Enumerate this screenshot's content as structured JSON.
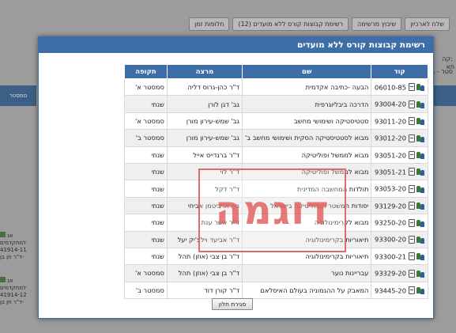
{
  "background": {
    "tabs": [
      "שלח לארכיון",
      "שיבוץ מרשימה",
      "רשימת קבוצות קורס ללא מועדים (12)",
      "חלופות זמן"
    ],
    "left_column_header": "סמסטר",
    "left_cells": [
      {
        "line1": "אנ",
        "line2": "למתקדמים",
        "line3": "41914-11",
        "line4": "ד\"ר חן בן-"
      },
      {
        "line1": "אנ",
        "line2": "למתקדמים",
        "line3": "41914-12",
        "line4": "ד\"ר חן בן-"
      }
    ],
    "right_label_1": "קה:",
    "right_label_2": "תא",
    "right_label_3": "סטר - מוע"
  },
  "modal": {
    "title": "רשימת קבוצות קורס ללא מועדים",
    "columns": {
      "code": "קוד",
      "name": "שם",
      "lecturer": "מרצה",
      "period": "תקופה"
    },
    "rows": [
      {
        "code": "06010-85",
        "name": "הבעה -כתיבה אקדמית",
        "lecturer": "ד\"ר כהן-גרוס דליה",
        "period": "סמסטר א'"
      },
      {
        "code": "93004-20",
        "name": "הדרכה ביבליוגרפית",
        "lecturer": "גב' דגן לורן",
        "period": "שנתי"
      },
      {
        "code": "93011-20",
        "name": "סטטיסטיקה ושימושי מחשב",
        "lecturer": "גב' שמש-עירון מורן",
        "period": "סמסטר א'"
      },
      {
        "code": "93012-20",
        "name": "מבוא לסטטיסטיקה הסקית ושימושי מחשב ב'",
        "lecturer": "גב' שמש-עירון מורן",
        "period": "סמסטר ב'"
      },
      {
        "code": "93051-20",
        "name": "מבוא לממשל ופוליטיקה",
        "lecturer": "ד\"ר ברנדייס אייל",
        "period": "שנתי"
      },
      {
        "code": "93051-21",
        "name": "מבוא לממשל ופוליטיקה",
        "lecturer": "ד\"ר לוי",
        "period": "שנתי"
      },
      {
        "code": "93053-20",
        "name": "תולדות המחשבה המדינית",
        "lecturer": "ד\"ר דקל",
        "period": "שנתי"
      },
      {
        "code": "93129-20",
        "name": "יסודות המשטר והפוליטיקה בישראל",
        "lecturer": "מר ארביטמן אביחי",
        "period": "שנתי"
      },
      {
        "code": "93250-20",
        "name": "מבוא לקרימינולוגיה",
        "lecturer": "ד\"ר אשר ענת",
        "period": "שנתי"
      },
      {
        "code": "93300-20",
        "name": "תיאוריות בקרימינולוגיה",
        "lecturer": "ד\"ר אביעד וילצ'יק יעל",
        "period": "שנתי"
      },
      {
        "code": "93300-21",
        "name": "תיאוריות בקרימינולוגיה",
        "lecturer": "ד\"ר בן צבי (אוזן) תהל",
        "period": "שנתי"
      },
      {
        "code": "93329-20",
        "name": "עבריינות נוער",
        "lecturer": "ד\"ר בן צבי (אוזן) תהל",
        "period": "סמסטר א'"
      },
      {
        "code": "93445-20",
        "name": "המאבק על ההגמוניה בעולם האיסלאם",
        "lecturer": "ד\"ר קורן דוד",
        "period": "סמסטר ב'"
      }
    ],
    "close_label": "סגירת חלון"
  },
  "watermark": "דוגמה"
}
